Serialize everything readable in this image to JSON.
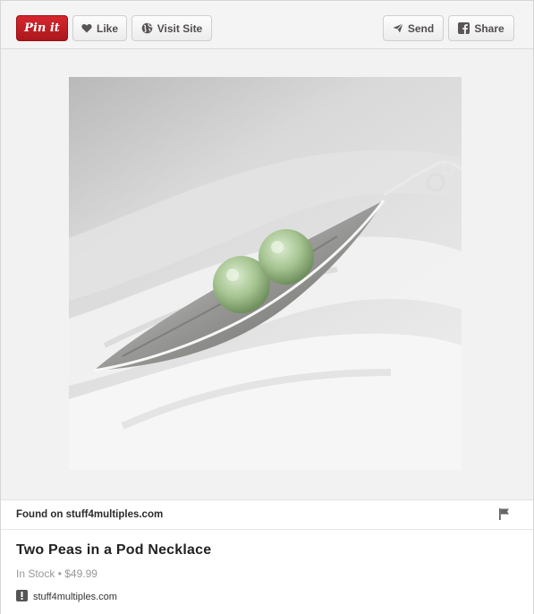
{
  "toolbar": {
    "pin_label": "Pin it",
    "like_label": "Like",
    "visit_label": "Visit Site",
    "send_label": "Send",
    "share_label": "Share"
  },
  "found": {
    "prefix": "Found on ",
    "domain": "stuff4multiples.com"
  },
  "product": {
    "title": "Two Peas in a Pod Necklace",
    "stock": "In Stock",
    "separator": " • ",
    "price": "$49.99"
  },
  "source": {
    "domain": "stuff4multiples.com"
  },
  "colors": {
    "pinterest_red": "#cb2027",
    "pea_green": "#a9c79a"
  }
}
